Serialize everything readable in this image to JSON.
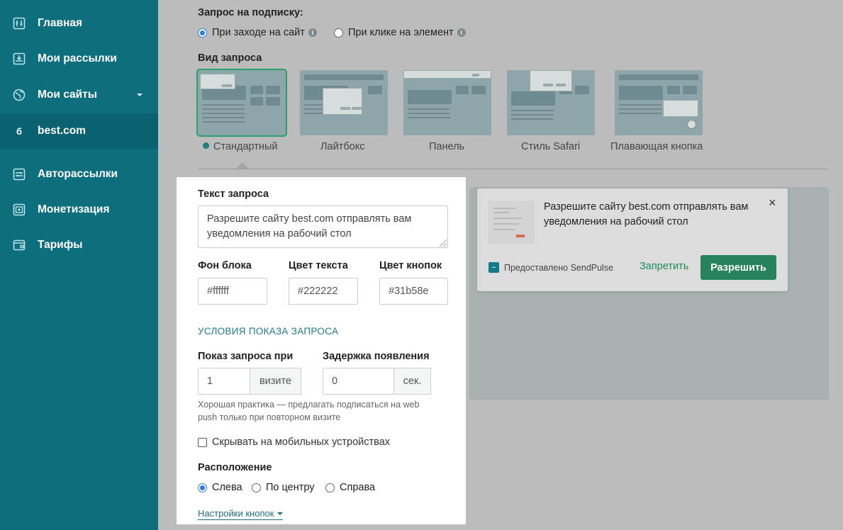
{
  "sidebar": {
    "items": [
      {
        "label": "Главная",
        "icon": "home-icon"
      },
      {
        "label": "Мои рассылки",
        "icon": "mailings-icon"
      },
      {
        "label": "Мои сайты",
        "icon": "globe-icon"
      },
      {
        "label": "best.com",
        "icon": "site-icon"
      },
      {
        "label": "Авторассылки",
        "icon": "automation-icon"
      },
      {
        "label": "Монетизация",
        "icon": "monetization-icon"
      },
      {
        "label": "Тарифы",
        "icon": "wallet-icon"
      }
    ]
  },
  "subscription": {
    "label": "Запрос на подписку:",
    "options": [
      "При заходе на сайт",
      "При клике на элемент"
    ],
    "selected": "При заходе на сайт"
  },
  "view": {
    "label": "Вид запроса",
    "types": [
      "Стандартный",
      "Лайтбокс",
      "Панель",
      "Стиль Safari",
      "Плавающая кнопка"
    ],
    "selected": "Стандартный"
  },
  "form": {
    "text_label": "Текст запроса",
    "text_value": "Разрешите сайту best.com отправлять вам уведомления на рабочий стол",
    "bg_label": "Фон блока",
    "bg_value": "#ffffff",
    "text_color_label": "Цвет текста",
    "text_color_value": "#222222",
    "btn_color_label": "Цвет кнопок",
    "btn_color_value": "#31b58e",
    "section_title": "УСЛОВИЯ ПОКАЗА ЗАПРОСА",
    "show_label": "Показ запроса при",
    "show_value": "1",
    "show_unit": "визите",
    "delay_label": "Задержка появления",
    "delay_value": "0",
    "delay_unit": "сек.",
    "hint": "Хорошая практика — предлагать подписаться на web push только при повторном визите",
    "hide_mobile_label": "Скрывать на мобильных устройствах",
    "position_label": "Расположение",
    "positions": [
      "Слева",
      "По центру",
      "Справа"
    ],
    "position_selected": "Слева",
    "button_settings": "Настройки кнопок"
  },
  "preview": {
    "message": "Разрешите сайту best.com отправлять вам уведомления на рабочий стол",
    "brand": "Предоставлено SendPulse",
    "deny": "Запретить",
    "allow": "Разрешить",
    "close": "×"
  },
  "colors": {
    "sidebar": "#0d6e7e",
    "accent_green": "#27835c",
    "selected_outline": "#27a06a",
    "link": "#1f7a8c"
  }
}
